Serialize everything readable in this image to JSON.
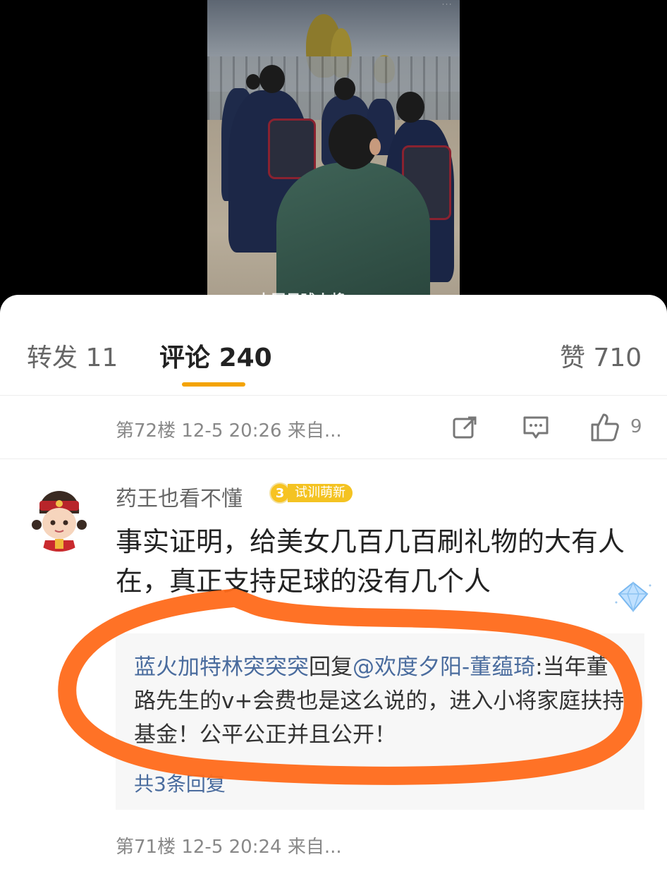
{
  "video": {
    "caption": "中国足球小将"
  },
  "tabs": [
    {
      "label": "转发",
      "count": "11"
    },
    {
      "label": "评论",
      "count": "240"
    },
    {
      "label": "赞",
      "count": "710"
    }
  ],
  "post72": {
    "floor_meta": "第72楼 12-5 20:26 来自...",
    "like_count": "9"
  },
  "comment": {
    "username": "药王也看不懂",
    "badge_level": "3",
    "badge_text": "试训萌新",
    "text": "事实证明，给美女几百几百刷礼物的大有人在，真正支持足球的没有几个人"
  },
  "reply": {
    "user": "蓝火加特林突突突",
    "verb": "回复",
    "target": "@欢度夕阳-董蕴琦",
    "text": ":当年董路先生的v+会费也是这么说的，进入小将家庭扶持基金！公平公正并且公开！",
    "more": "共3条回复"
  },
  "post71": {
    "floor_meta": "第71楼 12-5 20:24 来自..."
  },
  "colors": {
    "accent": "#f4a300",
    "link": "#4a6c9e",
    "annotation": "#ff6a1a"
  }
}
